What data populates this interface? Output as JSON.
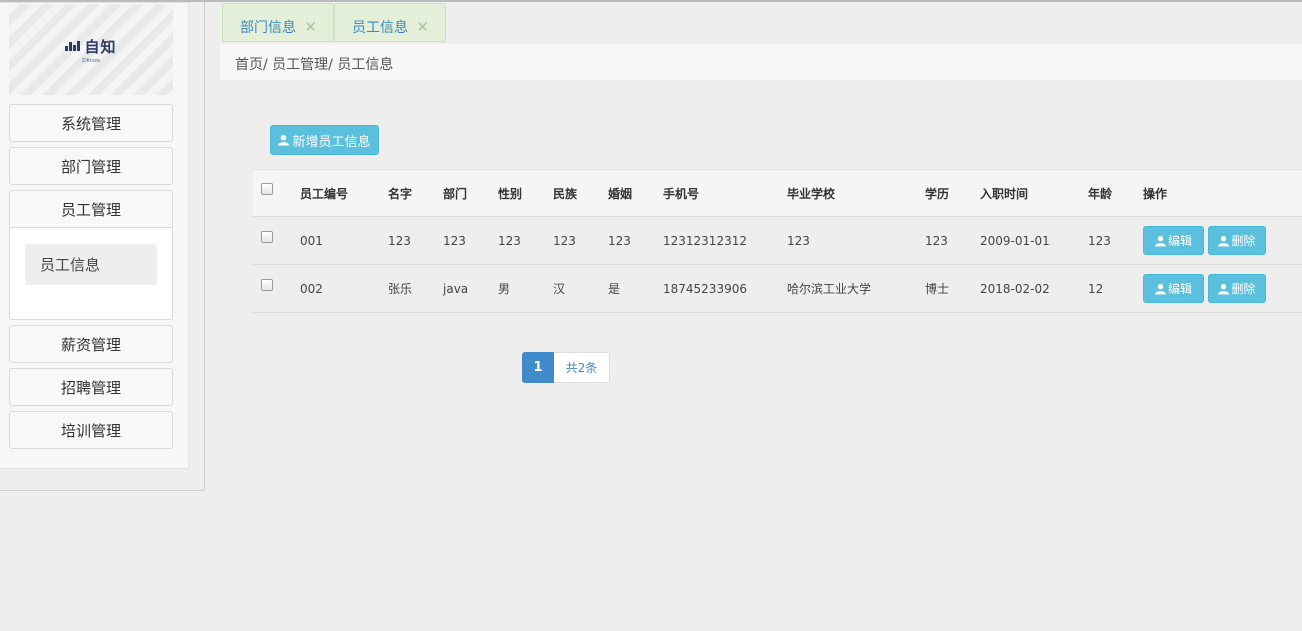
{
  "brand": {
    "logo_text": "自知",
    "logo_sub": "ZiKnow"
  },
  "sidebar": {
    "items": [
      {
        "label": "系统管理"
      },
      {
        "label": "部门管理"
      },
      {
        "label": "员工管理"
      },
      {
        "label": "薪资管理"
      },
      {
        "label": "招聘管理"
      },
      {
        "label": "培训管理"
      }
    ],
    "submenu": [
      {
        "label": "员工信息"
      }
    ]
  },
  "tabs": [
    {
      "label": "部门信息",
      "close": "✕"
    },
    {
      "label": "员工信息",
      "close": "✕"
    }
  ],
  "breadcrumb": "首页/ 员工管理/ 员工信息",
  "toolbar": {
    "add_label": "新增员工信息"
  },
  "table": {
    "headers": [
      "员工编号",
      "名字",
      "部门",
      "性别",
      "民族",
      "婚姻",
      "手机号",
      "毕业学校",
      "学历",
      "入职时间",
      "年龄",
      "操作"
    ],
    "rows": [
      [
        "001",
        "123",
        "123",
        "123",
        "123",
        "123",
        "12312312312",
        "123",
        "123",
        "2009-01-01",
        "123"
      ],
      [
        "002",
        "张乐",
        "java",
        "男",
        "汉",
        "是",
        "18745233906",
        "哈尔滨工业大学",
        "博士",
        "2018-02-02",
        "12"
      ]
    ],
    "edit_label": "编辑",
    "delete_label": "删除"
  },
  "pagination": {
    "current": "1",
    "total": "共2条"
  },
  "colors": {
    "accent": "#5bc0de",
    "primary": "#428bca",
    "tab_bg": "#e3efd9"
  },
  "icons": {
    "user": "user-icon",
    "close": "close-icon",
    "checkbox": "checkbox"
  }
}
